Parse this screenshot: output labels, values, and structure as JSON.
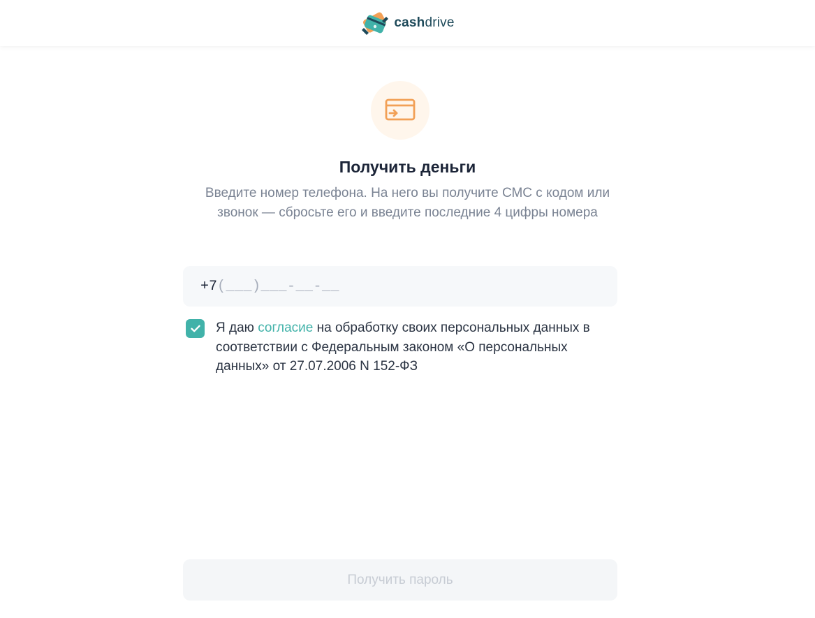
{
  "header": {
    "logo_bold": "cash",
    "logo_light": "drive"
  },
  "hero": {
    "icon": "card-transfer-icon",
    "title": "Получить деньги",
    "subtitle": "Введите номер телефона. На него вы получите СМС с кодом или звонок — сбросьте его и введите последние 4 цифры номера"
  },
  "phone_input": {
    "prefix": "+7",
    "mask": "(___)___-__-__",
    "value": ""
  },
  "consent": {
    "checked": true,
    "text_before": "Я даю ",
    "link_text": "согласие",
    "text_after": " на обработку своих персональных данных в соответствии с Федеральным законом «О персональных данных» от 27.07.2006 N 152-ФЗ"
  },
  "submit_button": {
    "label": "Получить пароль",
    "disabled": true
  },
  "colors": {
    "accent": "#41b2a9",
    "icon_orange": "#f2a056",
    "icon_bg": "#fff6ec",
    "logo_dark": "#1e4a5a"
  }
}
